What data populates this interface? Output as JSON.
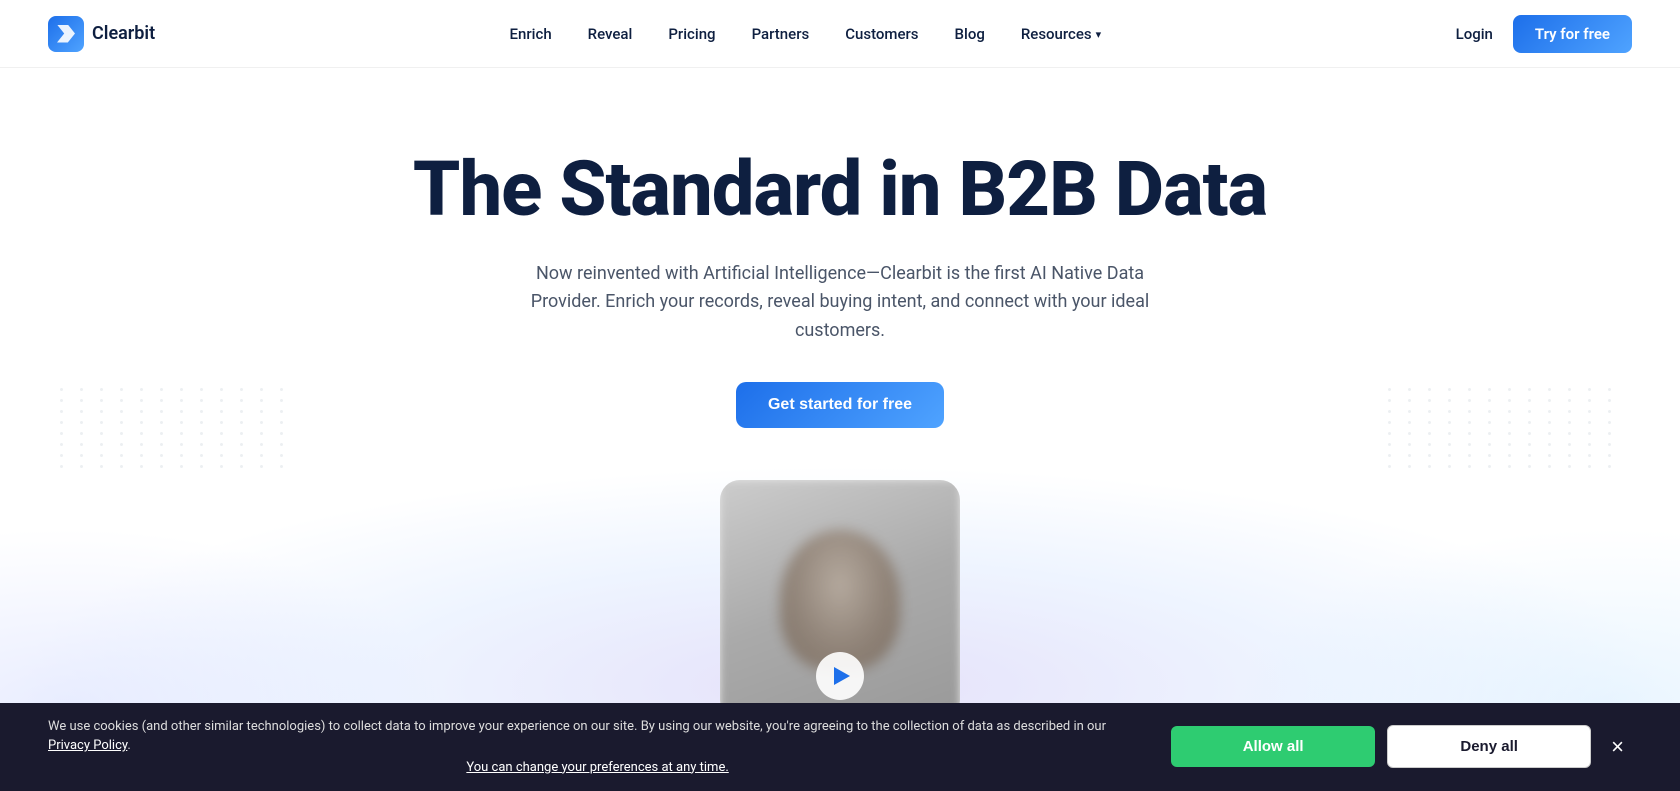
{
  "nav": {
    "logo_text": "Clearbit",
    "links": [
      {
        "label": "Enrich",
        "href": "#"
      },
      {
        "label": "Reveal",
        "href": "#"
      },
      {
        "label": "Pricing",
        "href": "#"
      },
      {
        "label": "Partners",
        "href": "#"
      },
      {
        "label": "Customers",
        "href": "#"
      },
      {
        "label": "Blog",
        "href": "#"
      },
      {
        "label": "Resources",
        "href": "#"
      }
    ],
    "login_label": "Login",
    "cta_label": "Try for free"
  },
  "hero": {
    "title": "The Standard in B2B Data",
    "subtitle": "Now reinvented with Artificial Intelligence—Clearbit is the first AI Native Data Provider. Enrich your records, reveal buying intent, and connect with your ideal customers.",
    "cta_label": "Get started for free"
  },
  "cookie": {
    "text": "We use cookies (and other similar technologies) to collect data to improve your experience on our site. By using our website, you're agreeing to the collection of data as described in our ",
    "privacy_link_label": "Privacy Policy",
    "change_text": "You can change your preferences at any time.",
    "allow_label": "Allow all",
    "deny_label": "Deny all",
    "close_label": "×"
  }
}
